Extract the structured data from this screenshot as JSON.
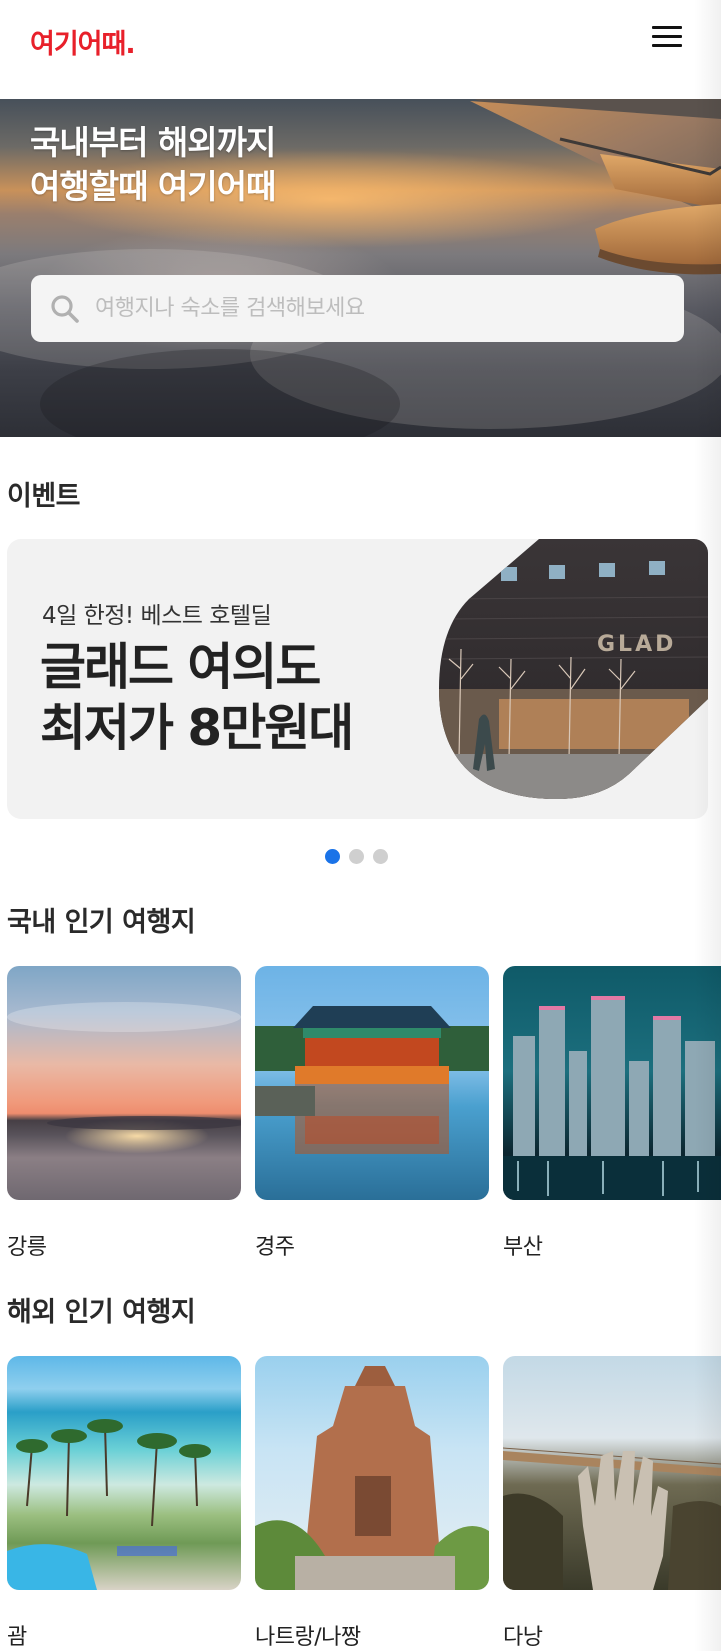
{
  "header": {
    "logo_text": "여기어때.",
    "brand_color": "#e8202a",
    "menu_icon": "hamburger-menu-icon"
  },
  "hero": {
    "title_line1": "국내부터 해외까지",
    "title_line2": "여행할때 여기어때",
    "search": {
      "icon": "search-icon",
      "placeholder": "여행지나 숙소를 검색해보세요",
      "value": ""
    }
  },
  "events": {
    "title": "이벤트",
    "banner": {
      "subtitle": "4일 한정! 베스트 호텔딜",
      "headline_line1": "글래드 여의도",
      "headline_line2": "최저가 8만원대",
      "photo_sign_text": "GLAD"
    },
    "pagination": {
      "total": 3,
      "active_index": 0,
      "active_color": "#1a73e8"
    }
  },
  "domestic": {
    "title": "국내 인기 여행지",
    "items": [
      {
        "name": "강릉"
      },
      {
        "name": "경주"
      },
      {
        "name": "부산"
      }
    ]
  },
  "overseas": {
    "title": "해외 인기 여행지",
    "items": [
      {
        "name": "괌"
      },
      {
        "name": "나트랑/나짱"
      },
      {
        "name": "다낭"
      }
    ]
  }
}
